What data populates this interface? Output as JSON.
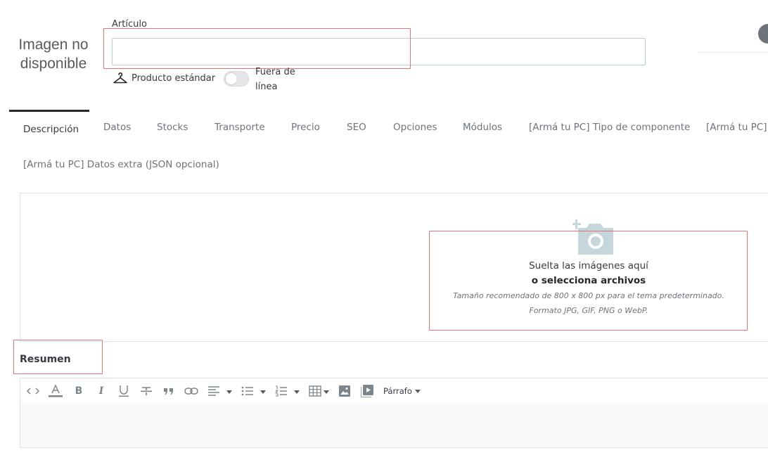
{
  "product": {
    "image_placeholder": "Imagen no disponible",
    "article_label": "Artículo",
    "article_value": "",
    "type_label": "Producto estándar",
    "offline_label": "Fuera de línea",
    "offline_enabled": false
  },
  "tabs": [
    {
      "label": "Descripción",
      "active": true
    },
    {
      "label": "Datos"
    },
    {
      "label": "Stocks"
    },
    {
      "label": "Transporte"
    },
    {
      "label": "Precio"
    },
    {
      "label": "SEO"
    },
    {
      "label": "Opciones"
    },
    {
      "label": "Módulos"
    },
    {
      "label": "[Armá tu PC] Tipo de componente"
    },
    {
      "label": "[Armá tu PC] S"
    },
    {
      "label": "[Armá tu PC] Datos extra (JSON opcional)"
    }
  ],
  "dropzone": {
    "icon": "camera-plus-icon",
    "main_text": "Suelta las imágenes aquí",
    "select_text": "o selecciona archivos",
    "size_hint": "Tamaño recomendado de 800 x 800 px para el tema predeterminado.",
    "format_hint": "Formato JPG, GIF, PNG o WebP."
  },
  "summary": {
    "heading": "Resumen",
    "toolbar": {
      "items": [
        "code-icon",
        "text-color-icon",
        "bold-icon",
        "italic-icon",
        "underline-icon",
        "strikethrough-icon",
        "quote-icon",
        "link-icon",
        "align-icon",
        "bullet-list-icon",
        "numbered-list-icon",
        "table-icon",
        "image-icon",
        "media-icon"
      ],
      "paragraph_label": "Párrafo"
    },
    "content": ""
  },
  "colors": {
    "highlight": "#e57373",
    "active_tab_underline": "#25292c"
  }
}
